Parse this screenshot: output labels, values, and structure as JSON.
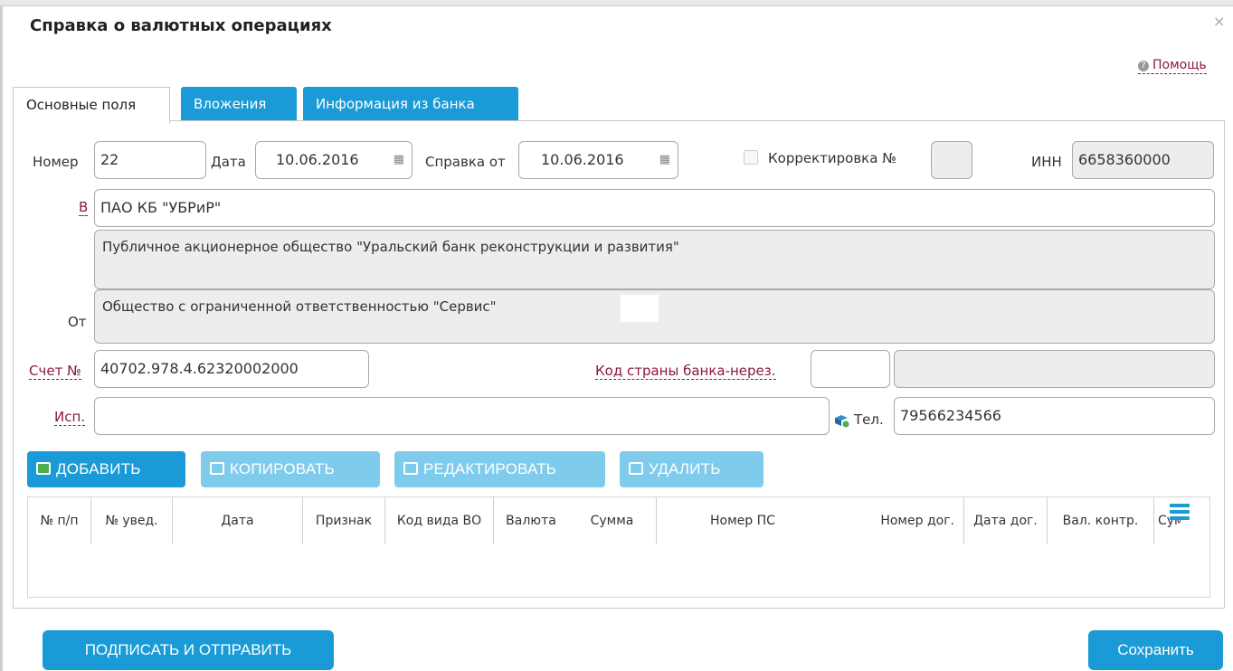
{
  "dialog": {
    "title": "Справка о валютных операциях",
    "close": "×",
    "help": "Помощь"
  },
  "tabs": [
    {
      "label": "Основные поля",
      "active": true
    },
    {
      "label": "Вложения",
      "active": false
    },
    {
      "label": "Информация из банка",
      "active": false
    }
  ],
  "form": {
    "number_label": "Номер",
    "number_value": "22",
    "date_label": "Дата",
    "date_value": "10.06.2016",
    "ref_date_label": "Справка от",
    "ref_date_value": "10.06.2016",
    "correction_label": "Корректировка №",
    "correction_value": "",
    "correction_checked": false,
    "inn_label": "ИНН",
    "inn_value": "6658360000",
    "to_label": "В",
    "to_value": "ПАО КБ \"УБРиР\"",
    "bank_full_name": "Публичное акционерное общество \"Уральский банк реконструкции и развития\"",
    "from_label": "От",
    "from_value": "Общество с ограниченной ответственностью \"Сервис\"",
    "account_label": "Счет №",
    "account_value": "40702.978.4.62320002000",
    "country_code_label": "Код страны банка-нерез.",
    "country_code_value": "",
    "country_name_value": "",
    "executor_label": "Исп.",
    "executor_value": "",
    "phone_label": "Тел.",
    "phone_value": "79566234566"
  },
  "toolbar": {
    "add": "ДОБАВИТЬ",
    "copy": "КОПИРОВАТЬ",
    "edit": "РЕДАКТИРОВАТЬ",
    "delete": "УДАЛИТЬ"
  },
  "table": {
    "columns": [
      "№ п/п",
      "№ увед.",
      "Дата",
      "Признак",
      "Код вида ВО",
      "Валюта",
      "Сумма",
      "Номер ПС",
      "Номер дог.",
      "Дата дог.",
      "Вал. контр.",
      "Сумма"
    ],
    "rows": []
  },
  "footer": {
    "sign_send": "ПОДПИСАТЬ И ОТПРАВИТЬ",
    "save": "Сохранить"
  },
  "colors": {
    "accent": "#1a9ad6",
    "accent_disabled": "#7fcbec",
    "required_label": "#8b1a3a",
    "readonly_bg": "#ededed"
  },
  "icons": [
    "close-icon",
    "help-icon",
    "calendar-icon",
    "phone-book-icon",
    "add-icon",
    "copy-icon",
    "edit-icon",
    "delete-icon",
    "column-menu-icon"
  ]
}
